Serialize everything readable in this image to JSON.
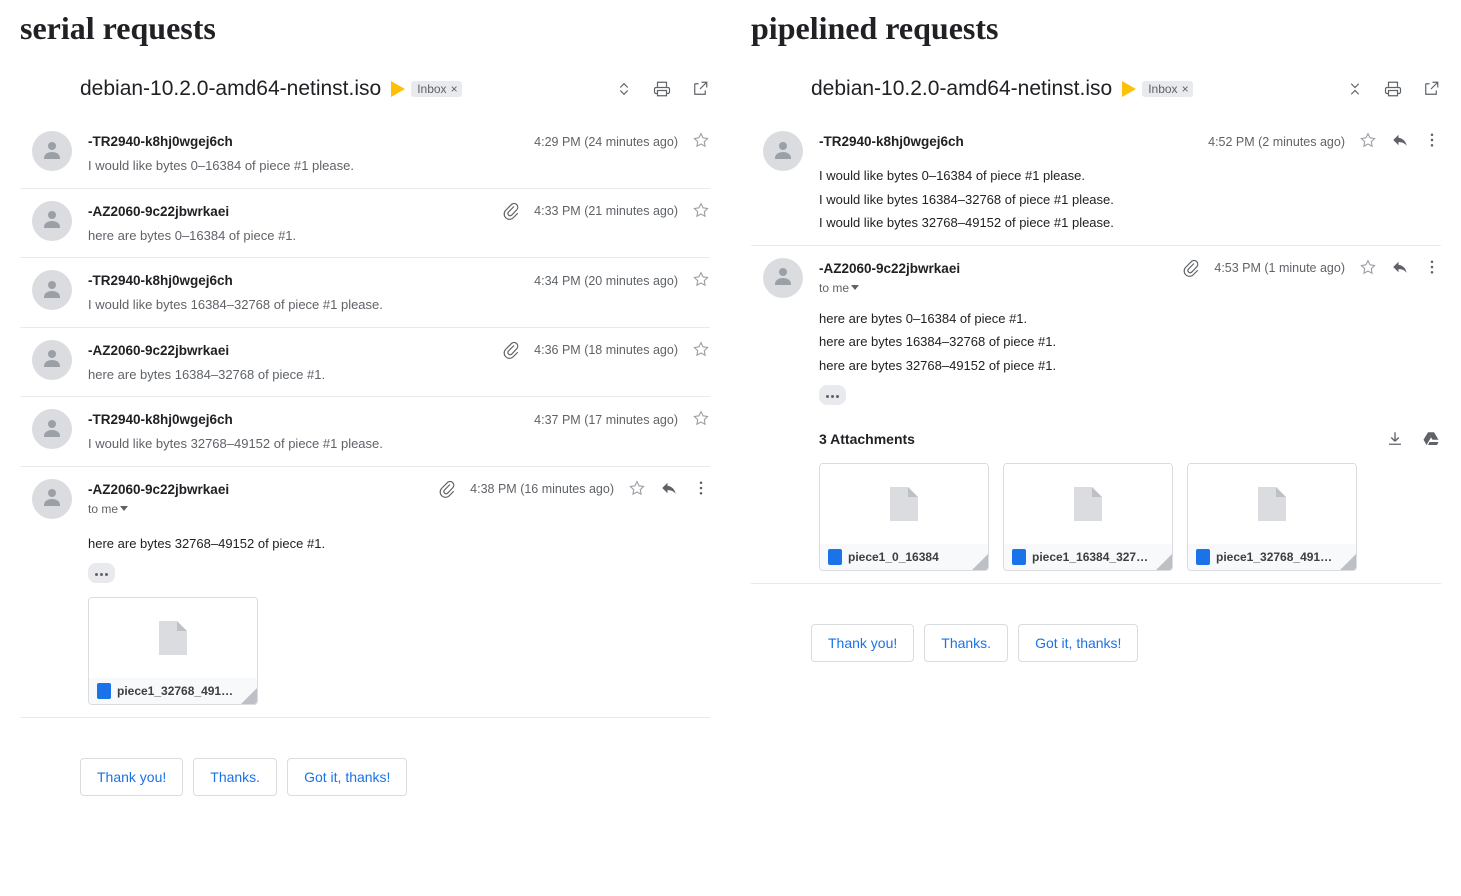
{
  "titles": {
    "left": "serial requests",
    "right": "pipelined requests"
  },
  "inbox_label": "Inbox",
  "subject": "debian-10.2.0-amd64-netinst.iso",
  "to_me_label": "to me",
  "attachments_label_single": "3 Attachments",
  "smart_replies": [
    "Thank you!",
    "Thanks.",
    "Got it, thanks!"
  ],
  "left": {
    "messages": [
      {
        "sender": "-TR2940-k8hj0wgej6ch",
        "snippet": "I would like bytes 0–16384 of piece #1 please.",
        "time": "4:29 PM (24 minutes ago)"
      },
      {
        "sender": "-AZ2060-9c22jbwrkaei",
        "snippet": "here are bytes 0–16384 of piece #1.",
        "time": "4:33 PM (21 minutes ago)",
        "has_attachment": true
      },
      {
        "sender": "-TR2940-k8hj0wgej6ch",
        "snippet": "I would like bytes 16384–32768 of piece #1 please.",
        "time": "4:34 PM (20 minutes ago)"
      },
      {
        "sender": "-AZ2060-9c22jbwrkaei",
        "snippet": "here are bytes 16384–32768 of piece #1.",
        "time": "4:36 PM (18 minutes ago)",
        "has_attachment": true
      },
      {
        "sender": "-TR2940-k8hj0wgej6ch",
        "snippet": "I would like bytes 32768–49152 of piece #1 please.",
        "time": "4:37 PM (17 minutes ago)"
      }
    ],
    "expanded": {
      "sender": "-AZ2060-9c22jbwrkaei",
      "time": "4:38 PM (16 minutes ago)",
      "lines": [
        "here are bytes 32768–49152 of piece #1."
      ],
      "attachments": [
        "piece1_32768_491…"
      ]
    }
  },
  "right": {
    "first": {
      "sender": "-TR2940-k8hj0wgej6ch",
      "time": "4:52 PM (2 minutes ago)",
      "lines": [
        "I would like bytes 0–16384 of piece #1 please.",
        "I would like bytes 16384–32768 of piece #1 please.",
        "I would like bytes 32768–49152 of piece #1 please."
      ]
    },
    "second": {
      "sender": "-AZ2060-9c22jbwrkaei",
      "time": "4:53 PM (1 minute ago)",
      "lines": [
        "here are bytes 0–16384 of piece #1.",
        "here are bytes 16384–32768 of piece #1.",
        "here are bytes 32768–49152 of piece #1."
      ],
      "attachments": [
        "piece1_0_16384",
        "piece1_16384_327…",
        "piece1_32768_491…"
      ]
    }
  }
}
